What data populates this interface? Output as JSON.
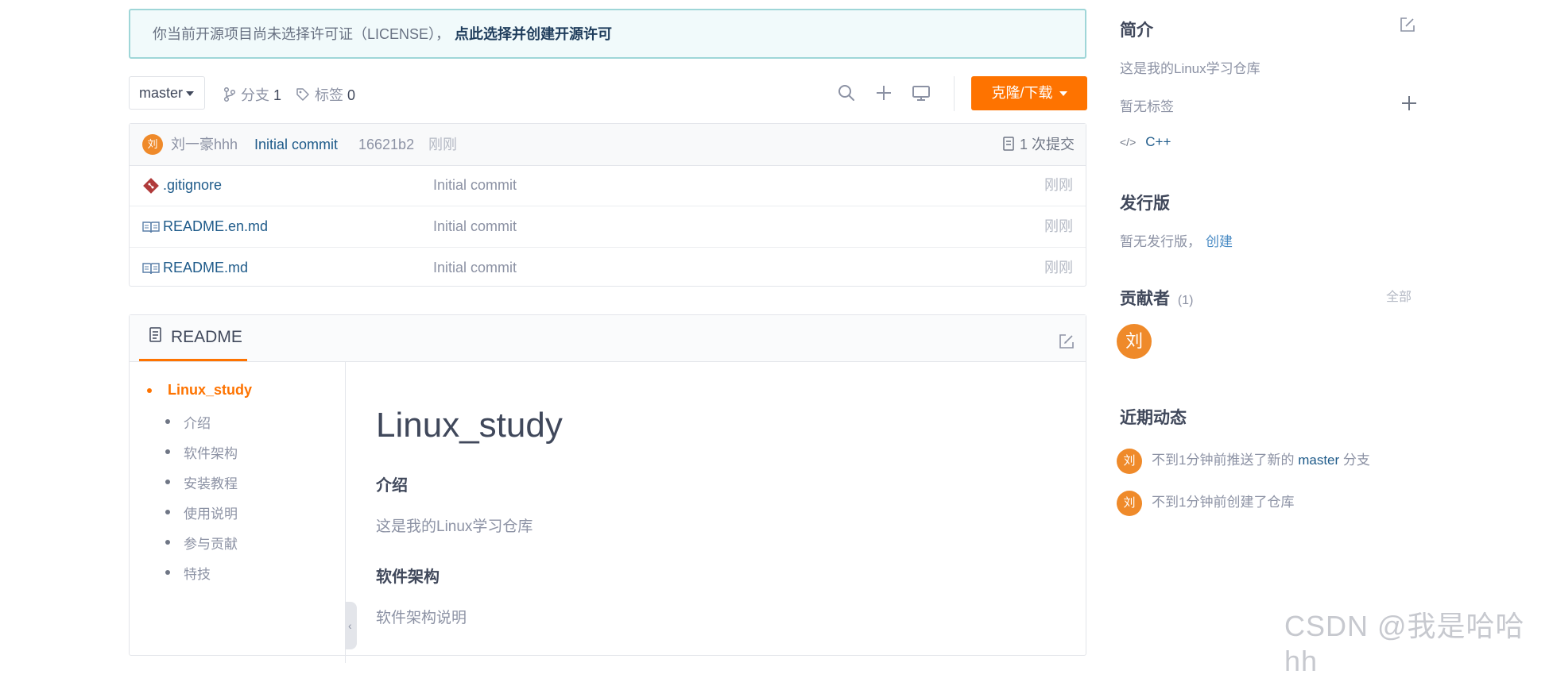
{
  "license": {
    "notice": "你当前开源项目尚未选择许可证（LICENSE），",
    "link": "点此选择并创建开源许可"
  },
  "toolbar": {
    "branch": "master",
    "branches_label": "分支",
    "branches_count": "1",
    "tags_label": "标签",
    "tags_count": "0",
    "clone_label": "克隆/下载"
  },
  "commit": {
    "avatar": "刘",
    "author": "刘一豪hhh",
    "message": "Initial commit",
    "hash": "16621b2",
    "time": "刚刚",
    "count_label": "1 次提交"
  },
  "files": [
    {
      "icon": "git-icon",
      "name": ".gitignore",
      "message": "Initial commit",
      "time": "刚刚"
    },
    {
      "icon": "book-icon",
      "name": "README.en.md",
      "message": "Initial commit",
      "time": "刚刚"
    },
    {
      "icon": "book-icon",
      "name": "README.md",
      "message": "Initial commit",
      "time": "刚刚"
    }
  ],
  "readme": {
    "tab_label": "README",
    "toc": {
      "root": "Linux_study",
      "items": [
        "介绍",
        "软件架构",
        "安装教程",
        "使用说明",
        "参与贡献",
        "特技"
      ]
    },
    "title": "Linux_study",
    "h_intro": "介绍",
    "p_intro": "这是我的Linux学习仓库",
    "h_arch": "软件架构",
    "p_arch": "软件架构说明"
  },
  "sidebar": {
    "intro_title": "简介",
    "intro_text": "这是我的Linux学习仓库",
    "no_tags": "暂无标签",
    "language": "C++",
    "release_title": "发行版",
    "release_text": "暂无发行版，",
    "release_create": "创建",
    "contributors_title": "贡献者",
    "contributors_count": "(1)",
    "contributors_all": "全部",
    "contributor_avatar": "刘",
    "activity_title": "近期动态",
    "activity": [
      {
        "avatar": "刘",
        "pre": "不到1分钟前推送了新的",
        "link": "master",
        "post": "分支"
      },
      {
        "avatar": "刘",
        "pre": "不到1分钟前创建了仓库",
        "link": "",
        "post": ""
      }
    ]
  },
  "watermark": "CSDN @我是哈哈hh",
  "colors": {
    "accent": "#fe7300",
    "link": "#1f5b8a",
    "avatar": "#ef8a2a"
  }
}
